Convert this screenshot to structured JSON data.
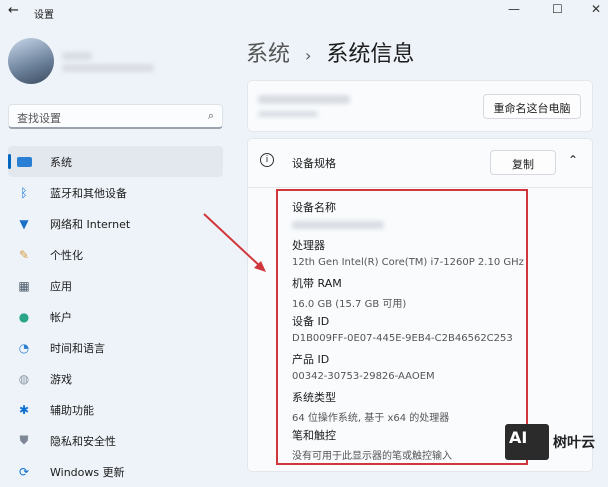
{
  "window": {
    "title": "设置",
    "back_icon": "←",
    "controls": [
      "—",
      "☐",
      "✕"
    ]
  },
  "search": {
    "placeholder": "查找设置"
  },
  "sidebar": {
    "items": [
      {
        "label": "系统",
        "icon": "monitor-icon"
      },
      {
        "label": "蓝牙和其他设备",
        "icon": "bluetooth-icon"
      },
      {
        "label": "网络和 Internet",
        "icon": "wifi-icon"
      },
      {
        "label": "个性化",
        "icon": "brush-icon"
      },
      {
        "label": "应用",
        "icon": "apps-icon"
      },
      {
        "label": "帐户",
        "icon": "account-icon"
      },
      {
        "label": "时间和语言",
        "icon": "clock-globe-icon"
      },
      {
        "label": "游戏",
        "icon": "gamepad-icon"
      },
      {
        "label": "辅助功能",
        "icon": "accessibility-icon"
      },
      {
        "label": "隐私和安全性",
        "icon": "shield-icon"
      },
      {
        "label": "Windows 更新",
        "icon": "update-icon"
      }
    ]
  },
  "breadcrumb": {
    "parent": "系统",
    "sep": "›",
    "current": "系统信息"
  },
  "device_card": {
    "rename_label": "重命名这台电脑"
  },
  "specs": {
    "title": "设备规格",
    "copy_label": "复制",
    "items": [
      {
        "label": "设备名称",
        "value": ""
      },
      {
        "label": "处理器",
        "value": "12th Gen Intel(R) Core(TM) i7-1260P   2.10 GHz"
      },
      {
        "label": "机带 RAM",
        "value": "16.0 GB (15.7 GB 可用)"
      },
      {
        "label": "设备 ID",
        "value": "D1B009FF-0E07-445E-9EB4-C2B46562C253"
      },
      {
        "label": "产品 ID",
        "value": "00342-30753-29826-AAOEM"
      },
      {
        "label": "系统类型",
        "value": "64 位操作系统, 基于 x64 的处理器"
      },
      {
        "label": "笔和触控",
        "value": "没有可用于此显示器的笔或触控输入"
      }
    ]
  },
  "watermark": {
    "logo": "AI",
    "text": "树叶云"
  }
}
